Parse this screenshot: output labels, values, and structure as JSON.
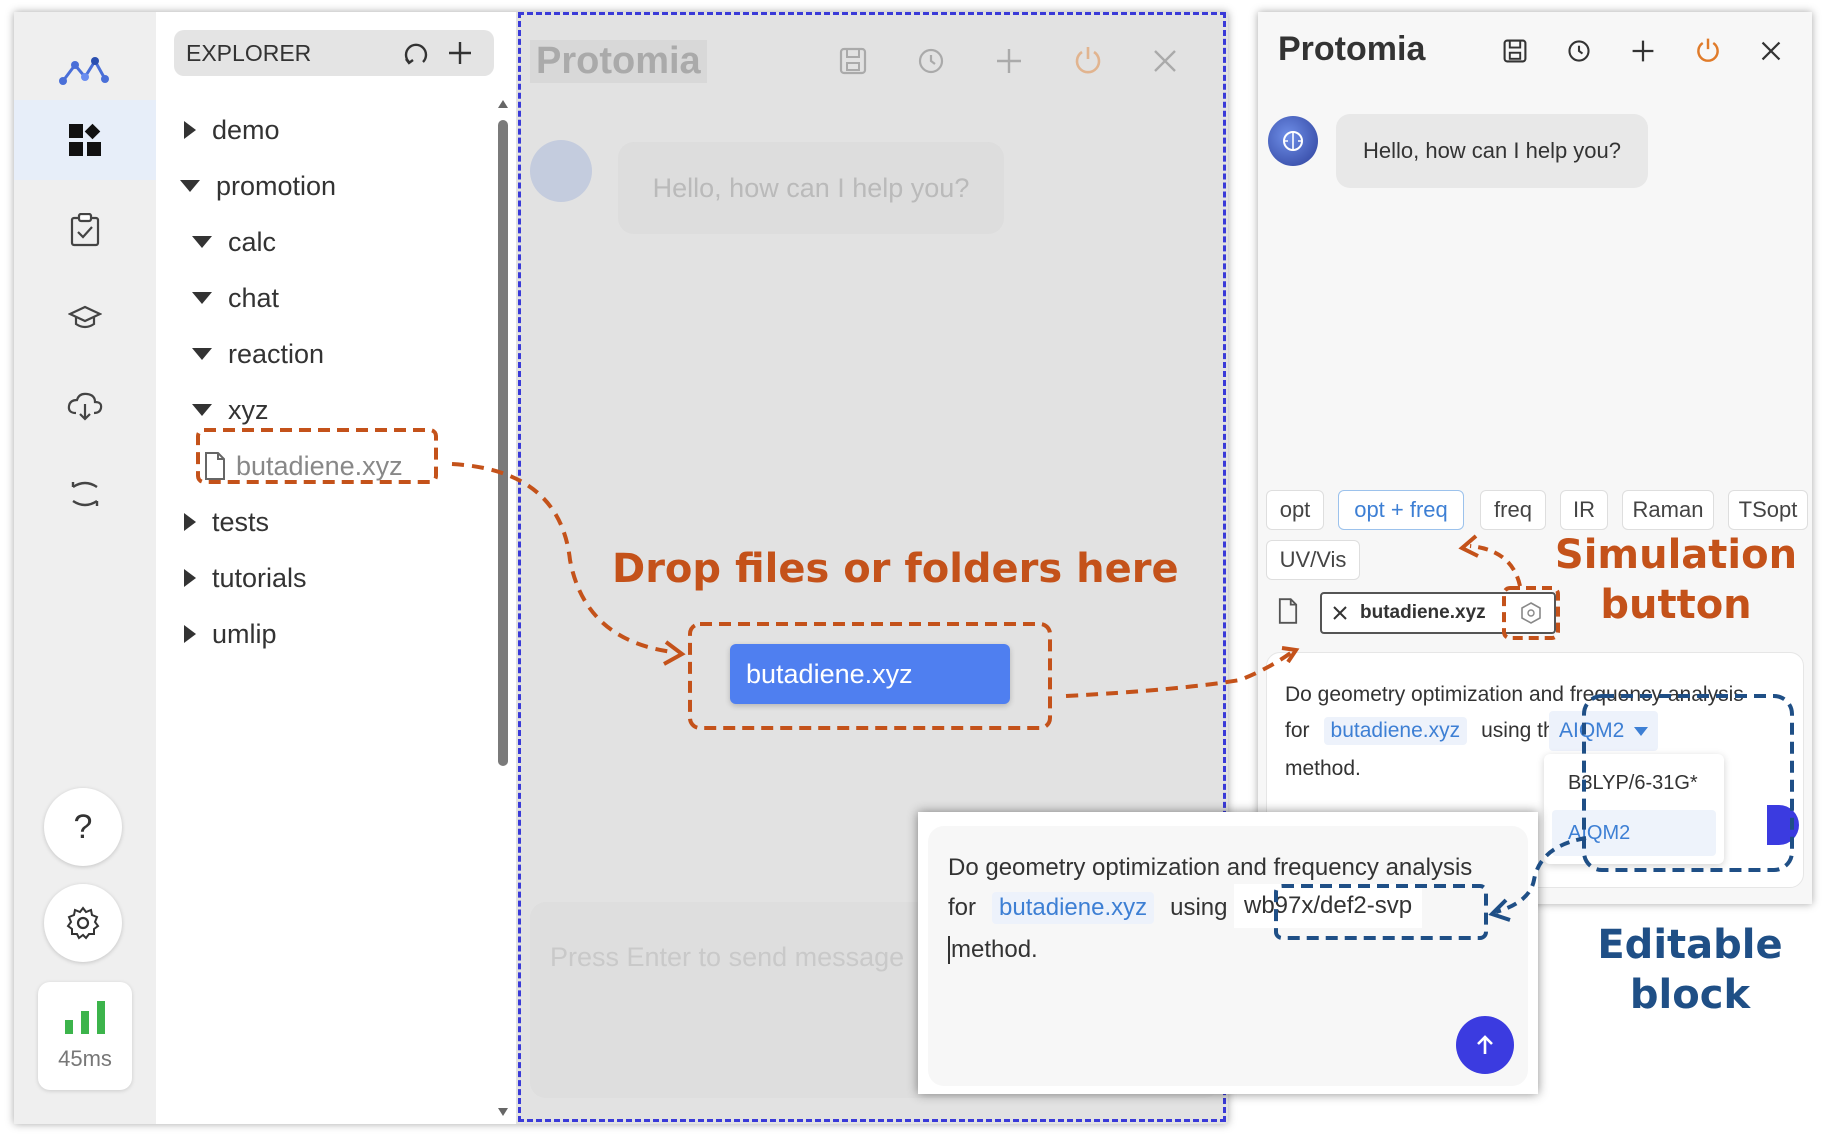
{
  "activity_bar": {
    "items": [
      {
        "name": "logo-icon"
      },
      {
        "name": "dashboard-icon",
        "active": true
      },
      {
        "name": "clipboard-check-icon"
      },
      {
        "name": "graduation-cap-icon"
      },
      {
        "name": "cloud-download-icon"
      },
      {
        "name": "sync-icon"
      }
    ],
    "help_label": "?",
    "latency": "45ms"
  },
  "explorer": {
    "title": "EXPLORER",
    "tree": [
      {
        "label": "demo",
        "state": "collapsed"
      },
      {
        "label": "promotion",
        "state": "expanded"
      },
      {
        "label": "calc",
        "state": "expanded"
      },
      {
        "label": "chat",
        "state": "expanded"
      },
      {
        "label": "reaction",
        "state": "expanded"
      },
      {
        "label": "xyz",
        "state": "expanded"
      },
      {
        "label": "butadiene.xyz",
        "state": "file"
      },
      {
        "label": "tests",
        "state": "collapsed"
      },
      {
        "label": "tutorials",
        "state": "collapsed"
      },
      {
        "label": "umlip",
        "state": "collapsed"
      }
    ]
  },
  "dropzone_panel": {
    "title": "Protomia",
    "greeting": "Hello, how can I help you?",
    "input_placeholder": "Press Enter to send message",
    "dragged_file": "butadiene.xyz"
  },
  "protomia": {
    "title": "Protomia",
    "greeting": "Hello, how can I help you?",
    "chips": [
      "opt",
      "opt + freq",
      "freq",
      "IR",
      "Raman",
      "TSopt",
      "UV/Vis"
    ],
    "selected_chip": "opt + freq",
    "attached_file": "butadiene.xyz",
    "prompt": {
      "text1": "Do geometry optimization and frequency analysis",
      "for": "for",
      "file": "butadiene.xyz",
      "using": "using the",
      "method": "AIQM2",
      "text_end": "method."
    },
    "method_options": [
      "B3LYP/6-31G*",
      "AIQM2"
    ],
    "selected_method": "AIQM2"
  },
  "editor_popup": {
    "text1": "Do geometry optimization and frequency analysis",
    "for": "for",
    "file": "butadiene.xyz",
    "using": "using the",
    "method": "wb97x/def2-svp",
    "text_end": "method."
  },
  "annotations": {
    "drop": "Drop files or folders here",
    "simulation_line1": "Simulation",
    "simulation_line2": "button",
    "editable_line1": "Editable",
    "editable_line2": "block"
  },
  "colors": {
    "annotation_orange": "#c4521a",
    "annotation_blue": "#1f4f86",
    "dropzone_border": "#3a3ad8",
    "accent_blue": "#3d7fd4",
    "drag_blue": "#4f7ff0",
    "send_button": "#3b3be0",
    "latency_green": "#3cb44b",
    "power_orange": "#e07b2a"
  }
}
